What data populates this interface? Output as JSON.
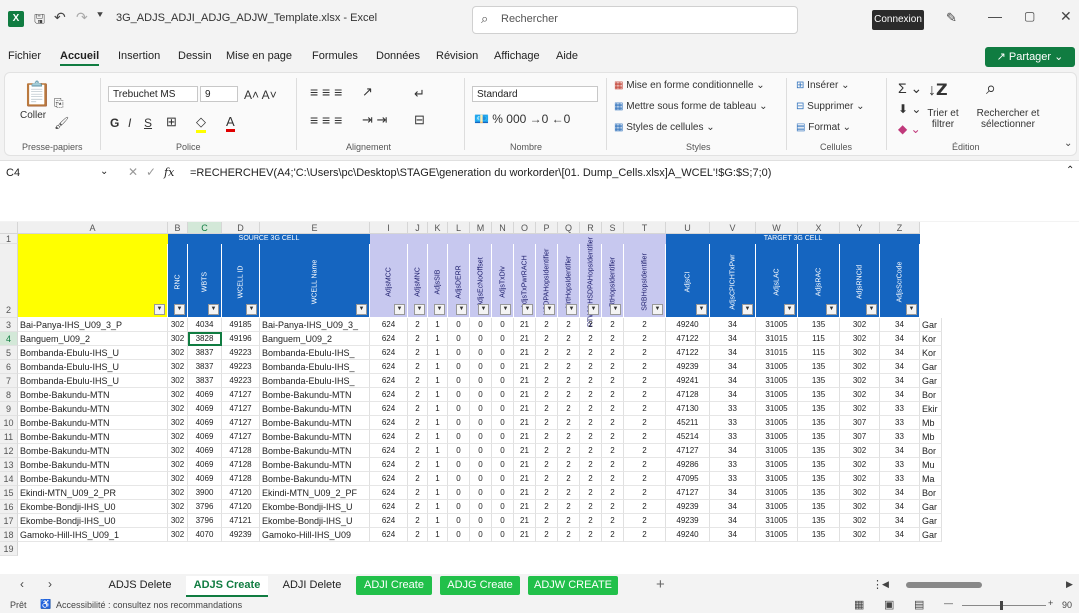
{
  "title": {
    "filename": "3G_ADJS_ADJI_ADJG_ADJW_Template.xlsx",
    "app": "Excel",
    "search_placeholder": "Rechercher",
    "connexion": "Connexion"
  },
  "menu": {
    "items": [
      "Fichier",
      "Accueil",
      "Insertion",
      "Dessin",
      "Mise en page",
      "Formules",
      "Données",
      "Révision",
      "Affichage",
      "Aide"
    ],
    "active": "Accueil",
    "share": "Partager"
  },
  "ribbon": {
    "clipboard": {
      "paste": "Coller",
      "group": "Presse-papiers"
    },
    "font": {
      "name": "Trebuchet MS",
      "size": "9",
      "bold": "G",
      "italic": "I",
      "underline": "S",
      "group": "Police"
    },
    "alignment": {
      "group": "Alignement"
    },
    "number": {
      "format": "Standard",
      "group": "Nombre"
    },
    "styles": {
      "conditional": "Mise en forme conditionnelle",
      "as_table": "Mettre sous forme de tableau",
      "cell_styles": "Styles de cellules",
      "group": "Styles"
    },
    "cells": {
      "insert": "Insérer",
      "delete": "Supprimer",
      "format": "Format",
      "group": "Cellules"
    },
    "editing": {
      "sort": "Trier et filtrer",
      "find": "Rechercher et sélectionner",
      "group": "Édition"
    }
  },
  "formula_bar": {
    "cell_ref": "C4",
    "fx": "fx",
    "formula": "=RECHERCHEV(A4;'C:\\Users\\pc\\Desktop\\STAGE\\generation du workorder\\[01. Dump_Cells.xlsx]A_WCEL'!$G:$S;7;0)"
  },
  "grid": {
    "columns": [
      "A",
      "B",
      "C",
      "D",
      "E",
      "I",
      "J",
      "K",
      "L",
      "M",
      "N",
      "O",
      "P",
      "Q",
      "R",
      "S",
      "T",
      "U",
      "V",
      "W",
      "X",
      "Y",
      "Z"
    ],
    "band_source": "SOURCE 3G CELL",
    "band_target": "TARGET 3G CELL",
    "headers": [
      "",
      "RNC",
      "WBTS",
      "WCELL ID",
      "WCELL Name",
      "AdjsMCC",
      "AdjsMNC",
      "AdjsSIB",
      "AdjsDERR",
      "AdjsEcNoOffset",
      "AdjsTxDiv",
      "AdjsTxPwrRACH",
      "HSDPAHopsIdentifier",
      "NrtHopsIdentifier",
      "RTWithHSDPAHopsIdentifier",
      "RtHopsIdentifier",
      "SRBHopsIdentifier",
      "AdjsCI",
      "AdjsCPICHTxPwr",
      "AdjsLAC",
      "AdjsRAC",
      "AdjsRNCid",
      "AdjsScrCode"
    ],
    "row_numbers": [
      "1",
      "2",
      "3",
      "4",
      "5",
      "6",
      "7",
      "8",
      "9",
      "10",
      "11",
      "12",
      "13",
      "14",
      "15",
      "16",
      "17",
      "18",
      "19"
    ],
    "rows": [
      [
        "Bai-Panya-IHS_U09_3_P",
        "302",
        "4034",
        "49185",
        "Bai-Panya-IHS_U09_3_",
        "624",
        "2",
        "1",
        "0",
        "0",
        "0",
        "21",
        "2",
        "2",
        "2",
        "2",
        "2",
        "49240",
        "34",
        "31005",
        "135",
        "302",
        "34",
        "Gar"
      ],
      [
        "Banguem_U09_2",
        "302",
        "3828",
        "49196",
        "Banguem_U09_2",
        "624",
        "2",
        "1",
        "0",
        "0",
        "0",
        "21",
        "2",
        "2",
        "2",
        "2",
        "2",
        "47122",
        "34",
        "31015",
        "115",
        "302",
        "34",
        "Kor"
      ],
      [
        "Bombanda-Ebulu-IHS_U",
        "302",
        "3837",
        "49223",
        "Bombanda-Ebulu-IHS_",
        "624",
        "2",
        "1",
        "0",
        "0",
        "0",
        "21",
        "2",
        "2",
        "2",
        "2",
        "2",
        "47122",
        "34",
        "31015",
        "115",
        "302",
        "34",
        "Kor"
      ],
      [
        "Bombanda-Ebulu-IHS_U",
        "302",
        "3837",
        "49223",
        "Bombanda-Ebulu-IHS_",
        "624",
        "2",
        "1",
        "0",
        "0",
        "0",
        "21",
        "2",
        "2",
        "2",
        "2",
        "2",
        "49239",
        "34",
        "31005",
        "135",
        "302",
        "34",
        "Gar"
      ],
      [
        "Bombanda-Ebulu-IHS_U",
        "302",
        "3837",
        "49223",
        "Bombanda-Ebulu-IHS_",
        "624",
        "2",
        "1",
        "0",
        "0",
        "0",
        "21",
        "2",
        "2",
        "2",
        "2",
        "2",
        "49241",
        "34",
        "31005",
        "135",
        "302",
        "34",
        "Gar"
      ],
      [
        "Bombe-Bakundu-MTN",
        "302",
        "4069",
        "47127",
        "Bombe-Bakundu-MTN",
        "624",
        "2",
        "1",
        "0",
        "0",
        "0",
        "21",
        "2",
        "2",
        "2",
        "2",
        "2",
        "47128",
        "34",
        "31005",
        "135",
        "302",
        "34",
        "Bor"
      ],
      [
        "Bombe-Bakundu-MTN",
        "302",
        "4069",
        "47127",
        "Bombe-Bakundu-MTN",
        "624",
        "2",
        "1",
        "0",
        "0",
        "0",
        "21",
        "2",
        "2",
        "2",
        "2",
        "2",
        "47130",
        "33",
        "31005",
        "135",
        "302",
        "33",
        "Ekir"
      ],
      [
        "Bombe-Bakundu-MTN",
        "302",
        "4069",
        "47127",
        "Bombe-Bakundu-MTN",
        "624",
        "2",
        "1",
        "0",
        "0",
        "0",
        "21",
        "2",
        "2",
        "2",
        "2",
        "2",
        "45211",
        "33",
        "31005",
        "135",
        "307",
        "33",
        "Mb"
      ],
      [
        "Bombe-Bakundu-MTN",
        "302",
        "4069",
        "47127",
        "Bombe-Bakundu-MTN",
        "624",
        "2",
        "1",
        "0",
        "0",
        "0",
        "21",
        "2",
        "2",
        "2",
        "2",
        "2",
        "45214",
        "33",
        "31005",
        "135",
        "307",
        "33",
        "Mb"
      ],
      [
        "Bombe-Bakundu-MTN",
        "302",
        "4069",
        "47128",
        "Bombe-Bakundu-MTN",
        "624",
        "2",
        "1",
        "0",
        "0",
        "0",
        "21",
        "2",
        "2",
        "2",
        "2",
        "2",
        "47127",
        "34",
        "31005",
        "135",
        "302",
        "34",
        "Bor"
      ],
      [
        "Bombe-Bakundu-MTN",
        "302",
        "4069",
        "47128",
        "Bombe-Bakundu-MTN",
        "624",
        "2",
        "1",
        "0",
        "0",
        "0",
        "21",
        "2",
        "2",
        "2",
        "2",
        "2",
        "49286",
        "33",
        "31005",
        "135",
        "302",
        "33",
        "Mu"
      ],
      [
        "Bombe-Bakundu-MTN",
        "302",
        "4069",
        "47128",
        "Bombe-Bakundu-MTN",
        "624",
        "2",
        "1",
        "0",
        "0",
        "0",
        "21",
        "2",
        "2",
        "2",
        "2",
        "2",
        "47095",
        "33",
        "31005",
        "135",
        "302",
        "33",
        "Ma"
      ],
      [
        "Ekindi-MTN_U09_2_PR",
        "302",
        "3900",
        "47120",
        "Ekindi-MTN_U09_2_PF",
        "624",
        "2",
        "1",
        "0",
        "0",
        "0",
        "21",
        "2",
        "2",
        "2",
        "2",
        "2",
        "47127",
        "34",
        "31005",
        "135",
        "302",
        "34",
        "Bor"
      ],
      [
        "Ekombe-Bondji-IHS_U0",
        "302",
        "3796",
        "47120",
        "Ekombe-Bondji-IHS_U",
        "624",
        "2",
        "1",
        "0",
        "0",
        "0",
        "21",
        "2",
        "2",
        "2",
        "2",
        "2",
        "49239",
        "34",
        "31005",
        "135",
        "302",
        "34",
        "Gar"
      ],
      [
        "Ekombe-Bondji-IHS_U0",
        "302",
        "3796",
        "47121",
        "Ekombe-Bondji-IHS_U",
        "624",
        "2",
        "1",
        "0",
        "0",
        "0",
        "21",
        "2",
        "2",
        "2",
        "2",
        "2",
        "49239",
        "34",
        "31005",
        "135",
        "302",
        "34",
        "Gar"
      ],
      [
        "Gamoko-Hill-IHS_U09_1",
        "302",
        "4070",
        "49239",
        "Gamoko-Hill-IHS_U09",
        "624",
        "2",
        "1",
        "0",
        "0",
        "0",
        "21",
        "2",
        "2",
        "2",
        "2",
        "2",
        "49240",
        "34",
        "31005",
        "135",
        "302",
        "34",
        "Gar"
      ]
    ],
    "selected_cell": "C4"
  },
  "sheets": {
    "tabs": [
      "ADJS Delete",
      "ADJS Create",
      "ADJI Delete",
      "ADJI Create",
      "ADJG Create",
      "ADJW CREATE"
    ],
    "active": "ADJS Create",
    "green": [
      "ADJI Create",
      "ADJG Create",
      "ADJW CREATE"
    ]
  },
  "status": {
    "ready": "Prêt",
    "accessibility": "Accessibilité : consultez nos recommandations",
    "zoom": "90"
  },
  "colors": {
    "excel_green": "#107c41",
    "header_blue": "#1565c0",
    "header_lavender": "#c7c8ef",
    "header_yellow": "#ffff00",
    "tab_green": "#21c04a"
  }
}
